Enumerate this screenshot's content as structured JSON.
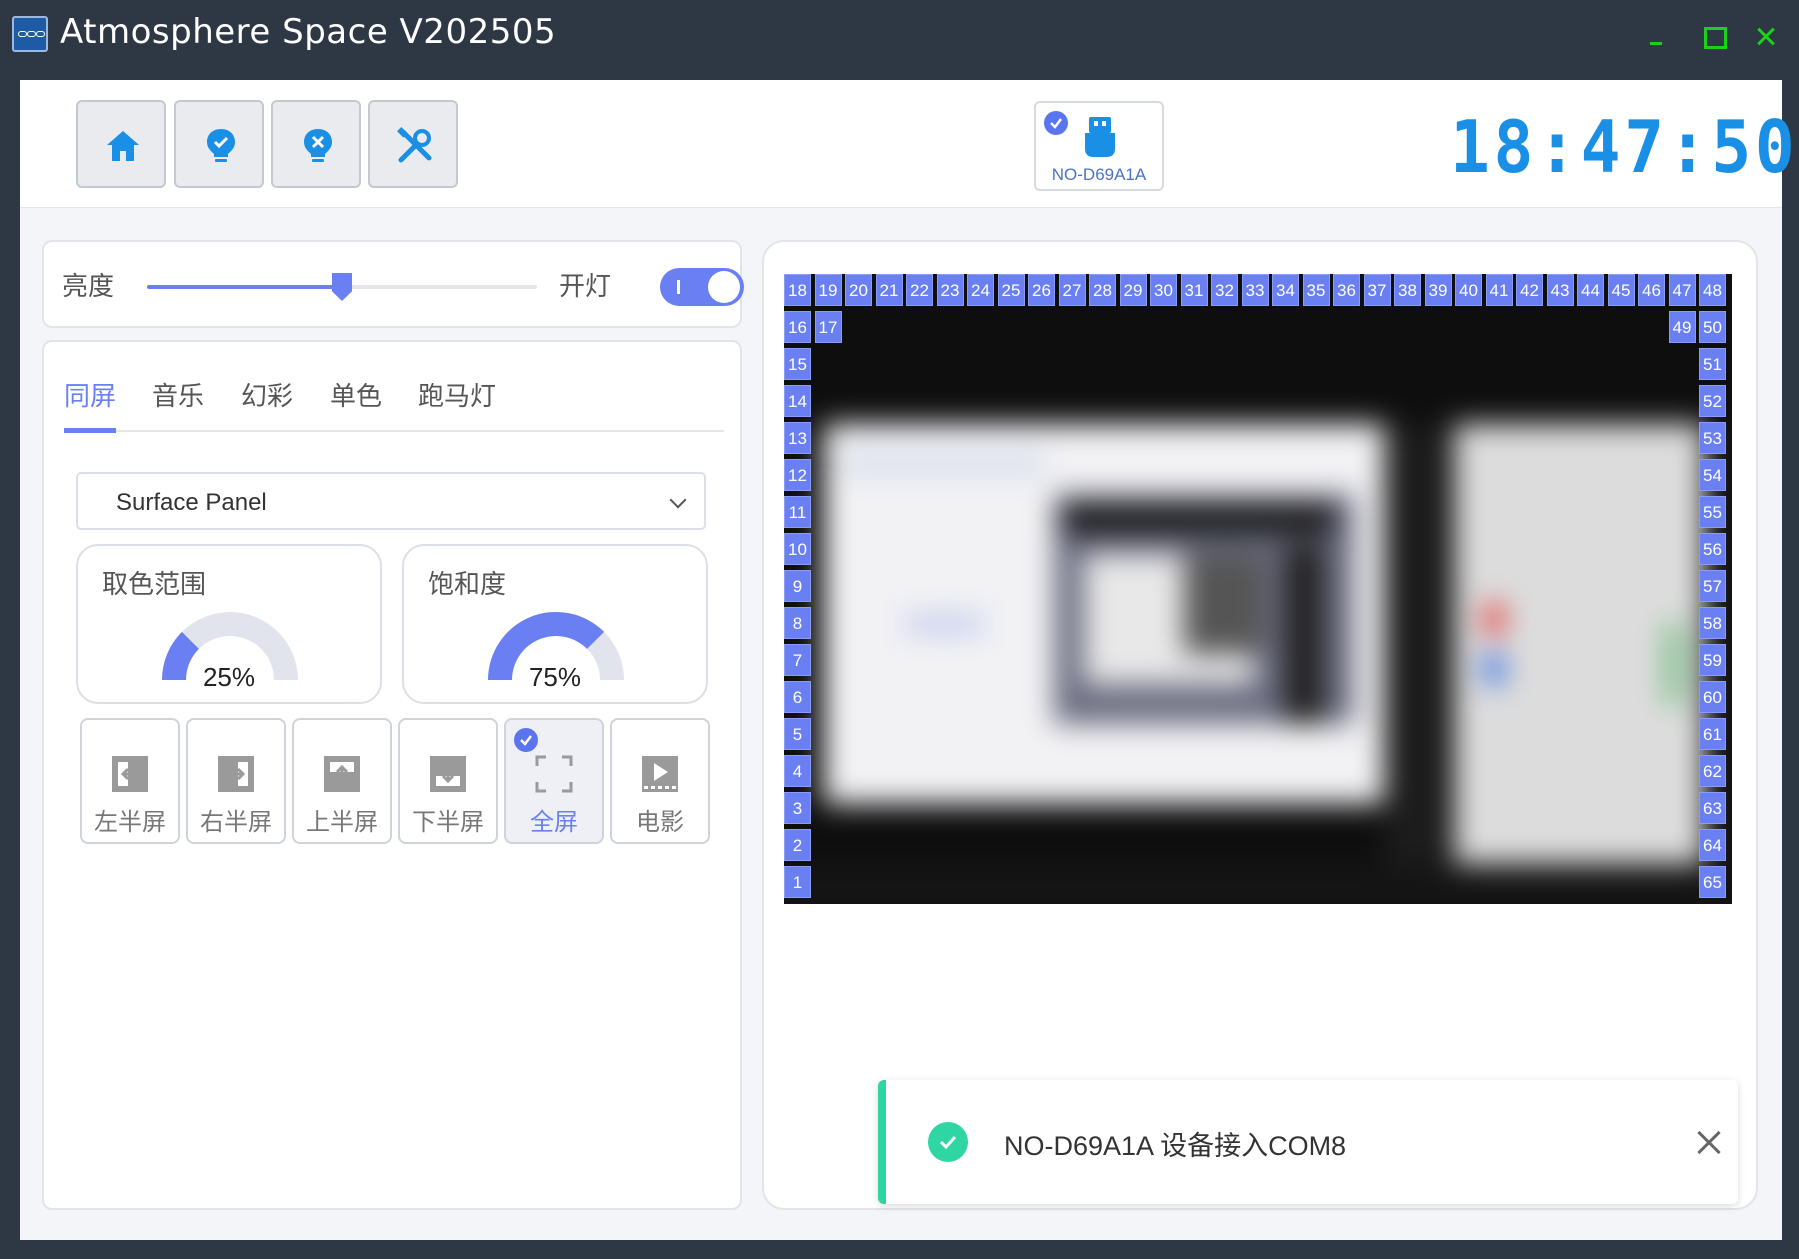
{
  "window": {
    "title": "Atmosphere Space V202505"
  },
  "toolbar": {
    "buttons": [
      {
        "icon": "home-icon"
      },
      {
        "icon": "lightbulb-check-icon"
      },
      {
        "icon": "lightbulb-off-icon"
      },
      {
        "icon": "tools-icon"
      }
    ],
    "device": {
      "name": "NO-D69A1A",
      "connected": true,
      "icon": "usb-icon"
    },
    "clock": "18:47:50"
  },
  "brightness": {
    "label": "亮度",
    "value": 0.5,
    "light_label": "开灯",
    "light_on": true
  },
  "modes": {
    "tabs": [
      {
        "label": "同屏",
        "active": true
      },
      {
        "label": "音乐",
        "active": false
      },
      {
        "label": "幻彩",
        "active": false
      },
      {
        "label": "单色",
        "active": false
      },
      {
        "label": "跑马灯",
        "active": false
      }
    ],
    "display_select": {
      "value": "Surface Panel"
    },
    "gauges": [
      {
        "title": "取色范围",
        "value": 0.25,
        "value_text": "25%"
      },
      {
        "title": "饱和度",
        "value": 0.75,
        "value_text": "75%"
      }
    ],
    "screen_options": [
      {
        "label": "左半屏",
        "icon": "left-half-icon",
        "selected": false
      },
      {
        "label": "右半屏",
        "icon": "right-half-icon",
        "selected": false
      },
      {
        "label": "上半屏",
        "icon": "top-half-icon",
        "selected": false
      },
      {
        "label": "下半屏",
        "icon": "bottom-half-icon",
        "selected": false
      },
      {
        "label": "全屏",
        "icon": "fullscreen-icon",
        "selected": true
      },
      {
        "label": "电影",
        "icon": "movie-icon",
        "selected": false
      }
    ]
  },
  "preview": {
    "leds_left": [
      "1",
      "2",
      "3",
      "4",
      "5",
      "6",
      "7",
      "8",
      "9",
      "10",
      "11",
      "12",
      "13",
      "14",
      "15",
      "16"
    ],
    "leds_top": [
      "18",
      "19",
      "20",
      "21",
      "22",
      "23",
      "24",
      "25",
      "26",
      "27",
      "28",
      "29",
      "30",
      "31",
      "32",
      "33",
      "34",
      "35",
      "36",
      "37",
      "38",
      "39",
      "40",
      "41",
      "42",
      "43",
      "44",
      "45",
      "46",
      "47",
      "48"
    ],
    "led_top_left_extra": "17",
    "led_top_right_extra": "49",
    "leds_right": [
      "50",
      "51",
      "52",
      "53",
      "54",
      "55",
      "56",
      "57",
      "58",
      "59",
      "60",
      "61",
      "62",
      "63",
      "64",
      "65"
    ]
  },
  "toast": {
    "message": "NO-D69A1A 设备接入COM8",
    "status": "success"
  },
  "colors": {
    "accent": "#6a80f2",
    "title_bar": "#2e3744",
    "window_controls": "#19d219",
    "clock": "#1a8fe6",
    "success": "#2fd6a3"
  }
}
